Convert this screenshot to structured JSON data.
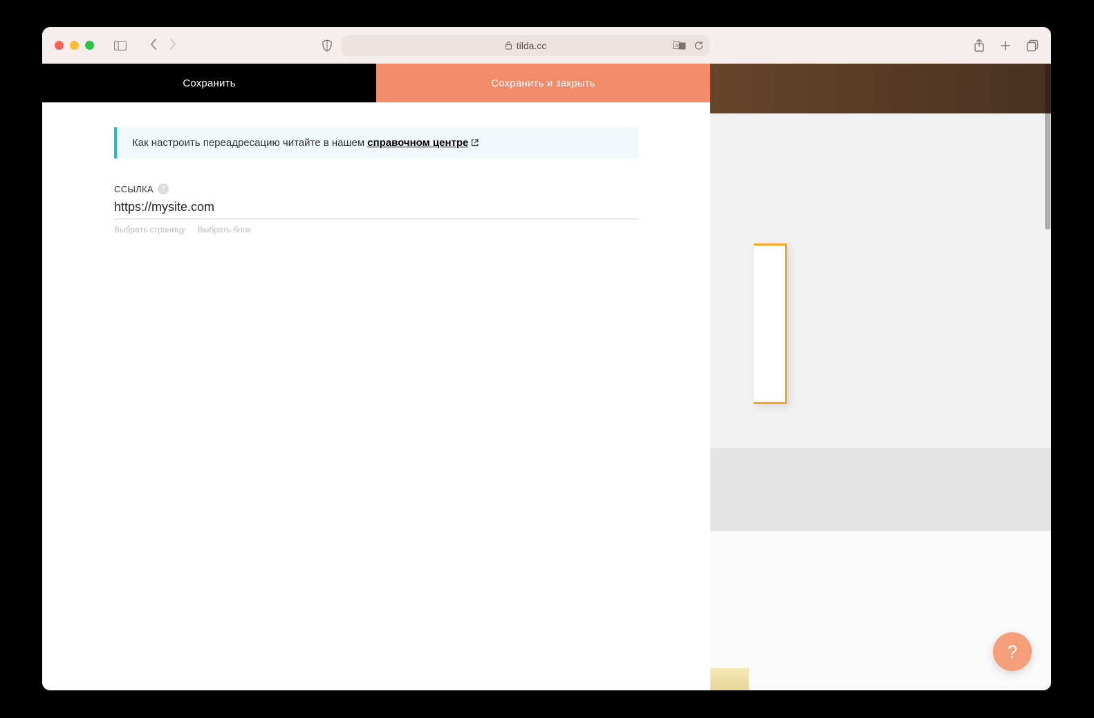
{
  "browser": {
    "url_host": "tilda.cc"
  },
  "tabs": {
    "save": "Сохранить",
    "save_close": "Сохранить и закрыть"
  },
  "info": {
    "text": "Как настроить переадресацию читайте в нашем ",
    "link_text": "справочном центре"
  },
  "field": {
    "label": "ССЫЛКА",
    "value": "https://mysite.com",
    "sub_page": "Выбрать страницу",
    "sub_block": "Выбрать блок"
  },
  "help_fab": "?"
}
